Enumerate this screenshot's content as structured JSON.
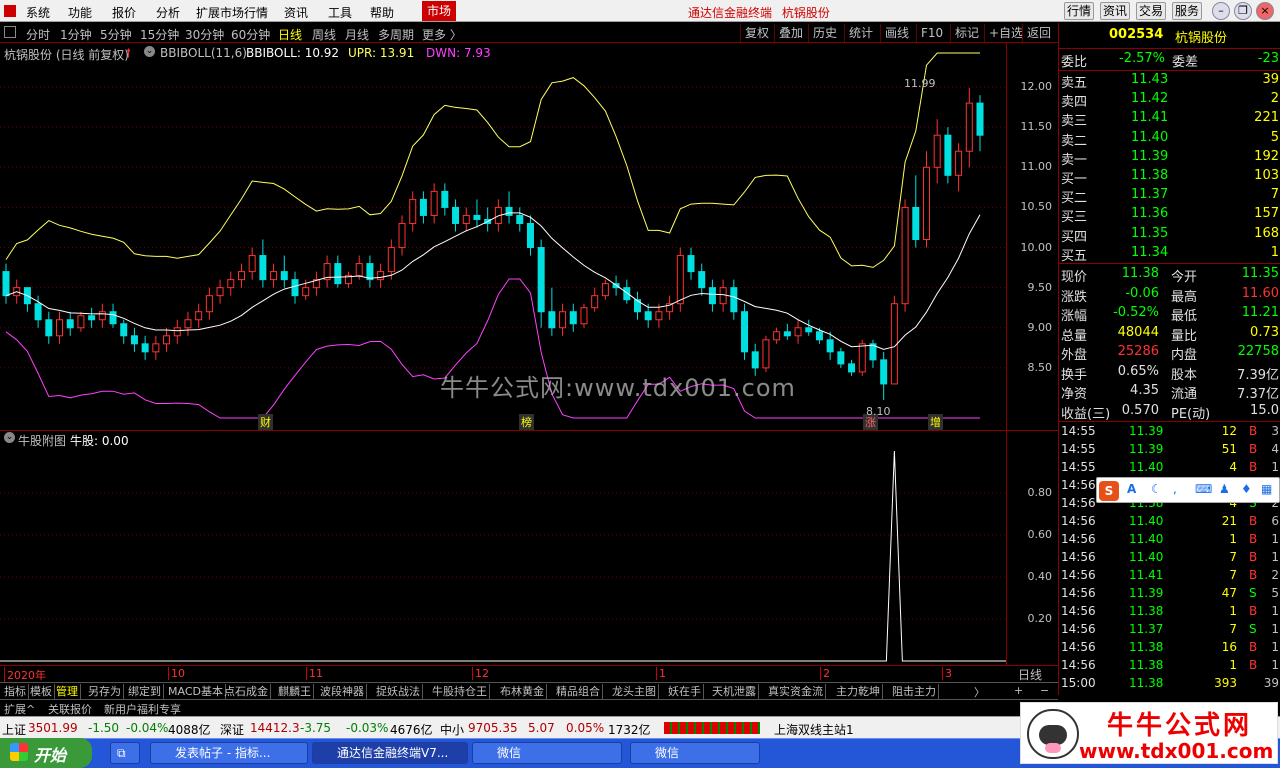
{
  "menu": {
    "items": [
      "系统",
      "功能",
      "报价",
      "分析",
      "扩展市场行情",
      "资讯",
      "工具",
      "帮助"
    ],
    "market_tab": "市场",
    "app_title": "通达信金融终端",
    "stock_title": "杭锅股份",
    "right_buttons": [
      "行情",
      "资讯",
      "交易",
      "服务"
    ]
  },
  "periods": {
    "items": [
      "分时",
      "1分钟",
      "5分钟",
      "15分钟",
      "30分钟",
      "60分钟",
      "日线",
      "周线",
      "月线",
      "多周期",
      "更多 〉"
    ],
    "active": "日线",
    "tools": [
      "复权",
      "叠加",
      "历史",
      "统计",
      "画线",
      "F10",
      "标记",
      "+自选",
      "返回"
    ]
  },
  "main_chart": {
    "stock_label": "杭锅股份 (日线 前复权)",
    "indicator_name": "BBIBOLL(11,6)",
    "bbiboll_label": "BBIBOLL: 10.92",
    "upr_label": "UPR: 13.91",
    "dwn_label": "DWN: 7.93",
    "high_marker": "11.99",
    "low_marker": "8.10",
    "event_labels": [
      "财",
      "榜",
      "涨",
      "增"
    ],
    "colors": {
      "up": "#ff3232",
      "down": "#00e0e0",
      "upr": "#ffff60",
      "mid": "#ffffff",
      "dwn": "#ff40ff"
    }
  },
  "sub_chart": {
    "label": "牛股附图",
    "value_label": "牛股: 0.00"
  },
  "watermark": "牛牛公式网:www.tdx001.com",
  "chart_data": [
    {
      "type": "candlestick",
      "title": "杭锅股份 (日线 前复权)",
      "ylim": [
        8.0,
        12.3
      ],
      "yticks": [
        8.5,
        9.0,
        9.5,
        10.0,
        10.5,
        11.0,
        11.5,
        12.0
      ],
      "x_labels": [
        "2020年",
        "10",
        "11",
        "12",
        "1",
        "2",
        "3"
      ],
      "ohlc": [
        [
          9.7,
          9.8,
          9.3,
          9.4
        ],
        [
          9.4,
          9.6,
          9.3,
          9.5
        ],
        [
          9.5,
          9.5,
          9.2,
          9.3
        ],
        [
          9.3,
          9.4,
          9.0,
          9.1
        ],
        [
          9.1,
          9.2,
          8.8,
          8.9
        ],
        [
          8.9,
          9.2,
          8.8,
          9.1
        ],
        [
          9.1,
          9.2,
          8.9,
          9.0
        ],
        [
          9.0,
          9.2,
          8.95,
          9.15
        ],
        [
          9.15,
          9.25,
          9.0,
          9.1
        ],
        [
          9.1,
          9.3,
          9.0,
          9.2
        ],
        [
          9.2,
          9.3,
          9.0,
          9.05
        ],
        [
          9.05,
          9.1,
          8.8,
          8.9
        ],
        [
          8.9,
          9.0,
          8.7,
          8.8
        ],
        [
          8.8,
          8.9,
          8.6,
          8.7
        ],
        [
          8.7,
          8.9,
          8.6,
          8.8
        ],
        [
          8.8,
          9.0,
          8.7,
          8.9
        ],
        [
          8.9,
          9.1,
          8.8,
          9.0
        ],
        [
          9.0,
          9.2,
          8.9,
          9.1
        ],
        [
          9.1,
          9.3,
          9.0,
          9.2
        ],
        [
          9.2,
          9.5,
          9.1,
          9.4
        ],
        [
          9.4,
          9.6,
          9.3,
          9.5
        ],
        [
          9.5,
          9.7,
          9.4,
          9.6
        ],
        [
          9.6,
          9.8,
          9.5,
          9.7
        ],
        [
          9.7,
          10.0,
          9.6,
          9.9
        ],
        [
          9.9,
          10.1,
          9.5,
          9.6
        ],
        [
          9.6,
          9.8,
          9.5,
          9.7
        ],
        [
          9.7,
          9.9,
          9.5,
          9.6
        ],
        [
          9.6,
          9.7,
          9.3,
          9.4
        ],
        [
          9.4,
          9.6,
          9.35,
          9.5
        ],
        [
          9.5,
          9.7,
          9.4,
          9.6
        ],
        [
          9.6,
          9.9,
          9.5,
          9.8
        ],
        [
          9.8,
          9.9,
          9.5,
          9.55
        ],
        [
          9.55,
          9.7,
          9.5,
          9.65
        ],
        [
          9.65,
          9.9,
          9.6,
          9.8
        ],
        [
          9.8,
          9.9,
          9.5,
          9.6
        ],
        [
          9.6,
          9.8,
          9.5,
          9.7
        ],
        [
          9.7,
          10.1,
          9.6,
          10.0
        ],
        [
          10.0,
          10.4,
          9.9,
          10.3
        ],
        [
          10.3,
          10.7,
          10.2,
          10.6
        ],
        [
          10.6,
          10.7,
          10.3,
          10.4
        ],
        [
          10.4,
          10.8,
          10.3,
          10.7
        ],
        [
          10.7,
          10.8,
          10.4,
          10.5
        ],
        [
          10.5,
          10.6,
          10.2,
          10.3
        ],
        [
          10.3,
          10.5,
          10.2,
          10.4
        ],
        [
          10.4,
          10.6,
          10.25,
          10.35
        ],
        [
          10.35,
          10.5,
          10.2,
          10.3
        ],
        [
          10.3,
          10.6,
          10.2,
          10.5
        ],
        [
          10.5,
          10.7,
          10.3,
          10.4
        ],
        [
          10.4,
          10.5,
          10.2,
          10.3
        ],
        [
          10.3,
          10.4,
          9.9,
          10.0
        ],
        [
          10.0,
          10.1,
          9.0,
          9.2
        ],
        [
          9.2,
          9.5,
          8.9,
          9.0
        ],
        [
          9.0,
          9.3,
          8.9,
          9.2
        ],
        [
          9.2,
          9.3,
          8.95,
          9.05
        ],
        [
          9.05,
          9.3,
          9.0,
          9.25
        ],
        [
          9.25,
          9.5,
          9.2,
          9.4
        ],
        [
          9.4,
          9.6,
          9.35,
          9.55
        ],
        [
          9.55,
          9.65,
          9.4,
          9.5
        ],
        [
          9.5,
          9.6,
          9.3,
          9.35
        ],
        [
          9.35,
          9.45,
          9.1,
          9.2
        ],
        [
          9.2,
          9.3,
          9.0,
          9.1
        ],
        [
          9.1,
          9.3,
          9.0,
          9.2
        ],
        [
          9.2,
          9.4,
          9.1,
          9.3
        ],
        [
          9.3,
          10.0,
          9.2,
          9.9
        ],
        [
          9.9,
          10.0,
          9.6,
          9.7
        ],
        [
          9.7,
          9.8,
          9.4,
          9.5
        ],
        [
          9.5,
          9.6,
          9.2,
          9.3
        ],
        [
          9.3,
          9.6,
          9.2,
          9.5
        ],
        [
          9.5,
          9.6,
          9.1,
          9.2
        ],
        [
          9.2,
          9.3,
          8.6,
          8.7
        ],
        [
          8.7,
          8.8,
          8.4,
          8.5
        ],
        [
          8.5,
          8.9,
          8.45,
          8.85
        ],
        [
          8.85,
          9.0,
          8.8,
          8.95
        ],
        [
          8.95,
          9.05,
          8.85,
          8.9
        ],
        [
          8.9,
          9.1,
          8.8,
          9.0
        ],
        [
          9.0,
          9.1,
          8.9,
          8.95
        ],
        [
          8.95,
          9.0,
          8.8,
          8.85
        ],
        [
          8.85,
          8.95,
          8.6,
          8.7
        ],
        [
          8.7,
          8.75,
          8.5,
          8.55
        ],
        [
          8.55,
          8.6,
          8.4,
          8.45
        ],
        [
          8.45,
          8.85,
          8.4,
          8.8
        ],
        [
          8.8,
          8.85,
          8.5,
          8.6
        ],
        [
          8.6,
          8.7,
          8.1,
          8.3
        ],
        [
          8.3,
          9.4,
          8.3,
          9.3
        ],
        [
          9.3,
          10.6,
          9.2,
          10.5
        ],
        [
          10.5,
          10.9,
          10.0,
          10.1
        ],
        [
          10.1,
          11.2,
          10.0,
          11.0
        ],
        [
          11.0,
          11.6,
          10.8,
          11.4
        ],
        [
          11.4,
          11.5,
          10.8,
          10.9
        ],
        [
          10.9,
          11.3,
          10.7,
          11.2
        ],
        [
          11.2,
          11.99,
          11.0,
          11.8
        ],
        [
          11.8,
          11.9,
          11.2,
          11.4
        ]
      ],
      "bbiboll_last": 10.92,
      "upr_last": 13.91,
      "dwn_last": 7.93
    },
    {
      "type": "line",
      "title": "牛股附图",
      "ylim": [
        0,
        1.0
      ],
      "yticks": [
        0.2,
        0.4,
        0.6,
        0.8
      ],
      "spike_value": 1.0,
      "last_value": 0.0
    }
  ],
  "period_label": "日线",
  "quote": {
    "code": "002534",
    "name": "杭锅股份",
    "weibi_label": "委比",
    "weibi": "-2.57%",
    "weicha_label": "委差",
    "weicha": "-23",
    "asks": [
      {
        "label": "卖五",
        "price": "11.43",
        "vol": "39"
      },
      {
        "label": "卖四",
        "price": "11.42",
        "vol": "2"
      },
      {
        "label": "卖三",
        "price": "11.41",
        "vol": "221"
      },
      {
        "label": "卖二",
        "price": "11.40",
        "vol": "5"
      },
      {
        "label": "卖一",
        "price": "11.39",
        "vol": "192"
      }
    ],
    "bids": [
      {
        "label": "买一",
        "price": "11.38",
        "vol": "103"
      },
      {
        "label": "买二",
        "price": "11.37",
        "vol": "7"
      },
      {
        "label": "买三",
        "price": "11.36",
        "vol": "157"
      },
      {
        "label": "买四",
        "price": "11.35",
        "vol": "168"
      },
      {
        "label": "买五",
        "price": "11.34",
        "vol": "1"
      }
    ],
    "stats": [
      {
        "l1": "现价",
        "v1": "11.38",
        "c1": "#00ff00",
        "l2": "今开",
        "v2": "11.35",
        "c2": "#00ff00"
      },
      {
        "l1": "涨跌",
        "v1": "-0.06",
        "c1": "#00ff00",
        "l2": "最高",
        "v2": "11.60",
        "c2": "#ff3232"
      },
      {
        "l1": "涨幅",
        "v1": "-0.52%",
        "c1": "#00ff00",
        "l2": "最低",
        "v2": "11.21",
        "c2": "#00ff00"
      },
      {
        "l1": "总量",
        "v1": "48044",
        "c1": "#ffff00",
        "l2": "量比",
        "v2": "0.73",
        "c2": "#ffff00"
      },
      {
        "l1": "外盘",
        "v1": "25286",
        "c1": "#ff3232",
        "l2": "内盘",
        "v2": "22758",
        "c2": "#00ff00"
      },
      {
        "l1": "换手",
        "v1": "0.65%",
        "c1": "#e0e0e0",
        "l2": "股本",
        "v2": "7.39亿",
        "c2": "#e0e0e0"
      },
      {
        "l1": "净资",
        "v1": "4.35",
        "c1": "#e0e0e0",
        "l2": "流通",
        "v2": "7.37亿",
        "c2": "#e0e0e0"
      },
      {
        "l1": "收益(三)",
        "v1": "0.570",
        "c1": "#e0e0e0",
        "l2": "PE(动)",
        "v2": "15.0",
        "c2": "#e0e0e0"
      }
    ],
    "ticks": [
      {
        "t": "14:55",
        "p": "11.39",
        "v": "12",
        "s": "B",
        "n": "3"
      },
      {
        "t": "14:55",
        "p": "11.39",
        "v": "51",
        "s": "B",
        "n": "4"
      },
      {
        "t": "14:55",
        "p": "11.40",
        "v": "4",
        "s": "B",
        "n": "1"
      },
      {
        "t": "14:56",
        "p": "11.40",
        "v": "1",
        "s": "B",
        "n": "1"
      },
      {
        "t": "14:56",
        "p": "11.38",
        "v": "4",
        "s": "S",
        "n": "2"
      },
      {
        "t": "14:56",
        "p": "11.40",
        "v": "21",
        "s": "B",
        "n": "6"
      },
      {
        "t": "14:56",
        "p": "11.40",
        "v": "1",
        "s": "B",
        "n": "1"
      },
      {
        "t": "14:56",
        "p": "11.40",
        "v": "7",
        "s": "B",
        "n": "1"
      },
      {
        "t": "14:56",
        "p": "11.41",
        "v": "7",
        "s": "B",
        "n": "2"
      },
      {
        "t": "14:56",
        "p": "11.39",
        "v": "47",
        "s": "S",
        "n": "5"
      },
      {
        "t": "14:56",
        "p": "11.38",
        "v": "1",
        "s": "B",
        "n": "1"
      },
      {
        "t": "14:56",
        "p": "11.37",
        "v": "7",
        "s": "S",
        "n": "1"
      },
      {
        "t": "14:56",
        "p": "11.38",
        "v": "16",
        "s": "B",
        "n": "1"
      },
      {
        "t": "14:56",
        "p": "11.38",
        "v": "1",
        "s": "B",
        "n": "1"
      },
      {
        "t": "15:00",
        "p": "11.38",
        "v": "393",
        "s": "",
        "n": "39"
      }
    ]
  },
  "bottom_tabs": {
    "items": [
      "指标",
      "模板",
      "管理",
      "另存为",
      "绑定到",
      "MACD基本",
      "点石成金",
      "麒麟王",
      "波段神器",
      "捉妖战法",
      "牛股持仓王",
      "布林黄金",
      "精品组合",
      "龙头主图",
      "妖在手",
      "天机泄露",
      "真实资金流",
      "主力乾坤",
      "阻击主力"
    ],
    "active": "管理",
    "more": "〉",
    "plus": "+",
    "minus": "−"
  },
  "ext_bar": {
    "items": [
      "扩展^",
      "关联报价",
      "新用户福利专享"
    ]
  },
  "status": {
    "sh_label": "上证",
    "sh_index": "3501.99",
    "sh_chg": "-1.50",
    "sh_pct": "-0.04%",
    "sh_amt": "4088亿",
    "sz_label": "深证",
    "sz_index": "14412.3",
    "sz_chg": "-3.75",
    "sz_pct": "-0.03%",
    "sz_amt": "4676亿",
    "zx_label": "中小",
    "zx_index": "9705.35",
    "zx_chg": "5.07",
    "zx_pct": "0.05%",
    "zx_amt": "1732亿",
    "server": "上海双线主站1"
  },
  "taskbar": {
    "start": "开始",
    "tasks": [
      "发表帖子 - 指标...",
      "通达信金融终端V7...",
      "微信",
      "微信"
    ]
  },
  "logo": {
    "title": "牛牛公式网",
    "url": "www.tdx001.com"
  }
}
